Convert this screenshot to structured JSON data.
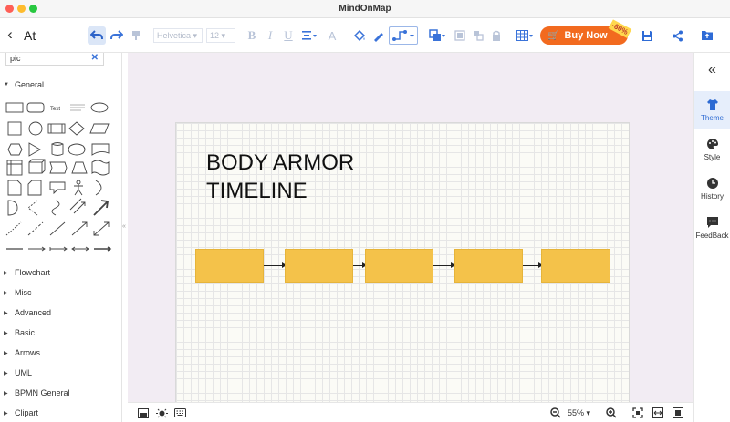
{
  "window": {
    "title": "MindOnMap"
  },
  "toolbar": {
    "back_label": "<",
    "doc_name": "At",
    "font_family": "Helvetica",
    "font_size": "12",
    "buy_label": "Buy Now",
    "discount": "-60%"
  },
  "left_panel": {
    "search_value": "pic",
    "general_label": "General",
    "shape_text_label": "Text",
    "categories": [
      "Flowchart",
      "Misc",
      "Advanced",
      "Basic",
      "Arrows",
      "UML",
      "BPMN General",
      "Clipart"
    ]
  },
  "canvas": {
    "title_line1": "BODY ARMOR",
    "title_line2": "TIMELINE",
    "box_color": "#f4c24a"
  },
  "bottom_bar": {
    "zoom": "55%"
  },
  "right_panel": {
    "items": [
      {
        "label": "Theme",
        "icon": "shirt-icon",
        "active": true
      },
      {
        "label": "Style",
        "icon": "palette-icon",
        "active": false
      },
      {
        "label": "History",
        "icon": "clock-icon",
        "active": false
      },
      {
        "label": "FeedBack",
        "icon": "chat-icon",
        "active": false
      }
    ]
  },
  "colors": {
    "accent": "#2e6bd6",
    "buy_button": "#f26a1f",
    "canvas_bg": "#f2ecf3"
  }
}
